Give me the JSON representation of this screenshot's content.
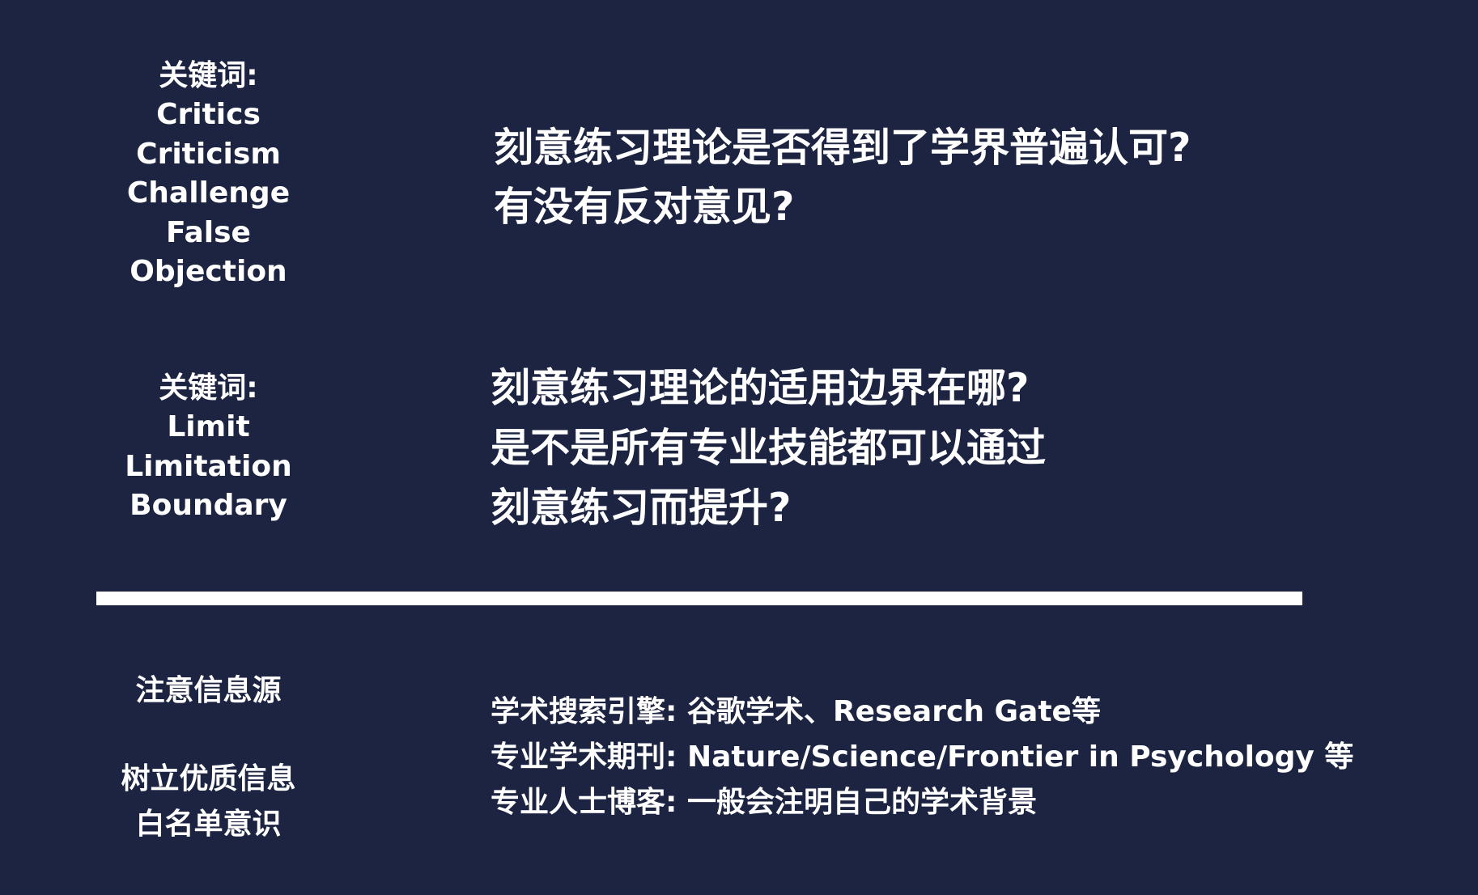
{
  "keywords_critique": {
    "label": "关键词:",
    "terms": [
      "Critics",
      "Criticism",
      "Challenge",
      "False",
      "Objection"
    ]
  },
  "question_critique": {
    "lines": [
      "刻意练习理论是否得到了学界普遍认可?",
      "有没有反对意见?"
    ]
  },
  "keywords_limit": {
    "label": "关键词:",
    "terms": [
      "Limit",
      "Limitation",
      "Boundary"
    ]
  },
  "question_limit": {
    "lines": [
      "刻意练习理论的适用边界在哪?",
      "是不是所有专业技能都可以通过",
      "刻意练习而提升?"
    ]
  },
  "notes": {
    "source": "注意信息源",
    "whitelist": [
      "树立优质信息",
      "白名单意识"
    ]
  },
  "sources": [
    {
      "label": "学术搜索引擎:",
      "value": "谷歌学术、Research Gate等"
    },
    {
      "label": "专业学术期刊:",
      "value": "Nature/Science/Frontier in Psychology 等"
    },
    {
      "label": "专业人士博客:",
      "value": "一般会注明自己的学术背景"
    }
  ],
  "colors": {
    "background": "#1c2442",
    "text": "#ffffff"
  }
}
